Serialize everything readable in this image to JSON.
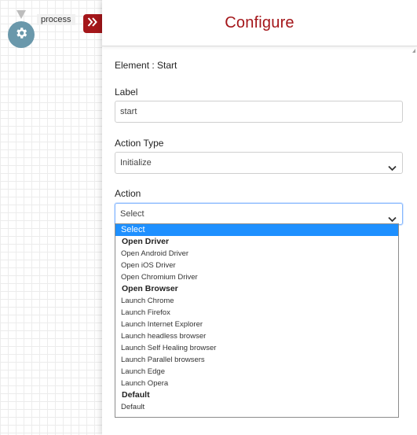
{
  "canvas": {
    "node_label": "process",
    "node_icon": "gear-icon",
    "collapse_icon": "double-chevron-right-icon"
  },
  "panel": {
    "title": "Configure",
    "element_line": "Element : Start",
    "label_field": {
      "label": "Label",
      "value": "start"
    },
    "action_type": {
      "label": "Action Type",
      "value": "Initialize"
    },
    "action": {
      "label": "Action",
      "value": "Select"
    }
  },
  "dropdown": {
    "options": [
      {
        "text": "Select",
        "kind": "selected"
      },
      {
        "text": "Open Driver",
        "kind": "group"
      },
      {
        "text": "Open Android Driver",
        "kind": "option"
      },
      {
        "text": "Open iOS Driver",
        "kind": "option"
      },
      {
        "text": "Open Chromium Driver",
        "kind": "option"
      },
      {
        "text": "Open Browser",
        "kind": "group"
      },
      {
        "text": "Launch Chrome",
        "kind": "option"
      },
      {
        "text": "Launch Firefox",
        "kind": "option"
      },
      {
        "text": "Launch Internet Explorer",
        "kind": "option"
      },
      {
        "text": "Launch headless browser",
        "kind": "option"
      },
      {
        "text": "Launch Self Healing browser",
        "kind": "option"
      },
      {
        "text": "Launch Parallel browsers",
        "kind": "option"
      },
      {
        "text": "Launch Edge",
        "kind": "option"
      },
      {
        "text": "Launch Opera",
        "kind": "option"
      },
      {
        "text": "Default",
        "kind": "group"
      },
      {
        "text": "Default",
        "kind": "option"
      }
    ]
  },
  "colors": {
    "accent": "#a4161a",
    "node": "#6a98ab",
    "selection": "#1e90ff"
  }
}
